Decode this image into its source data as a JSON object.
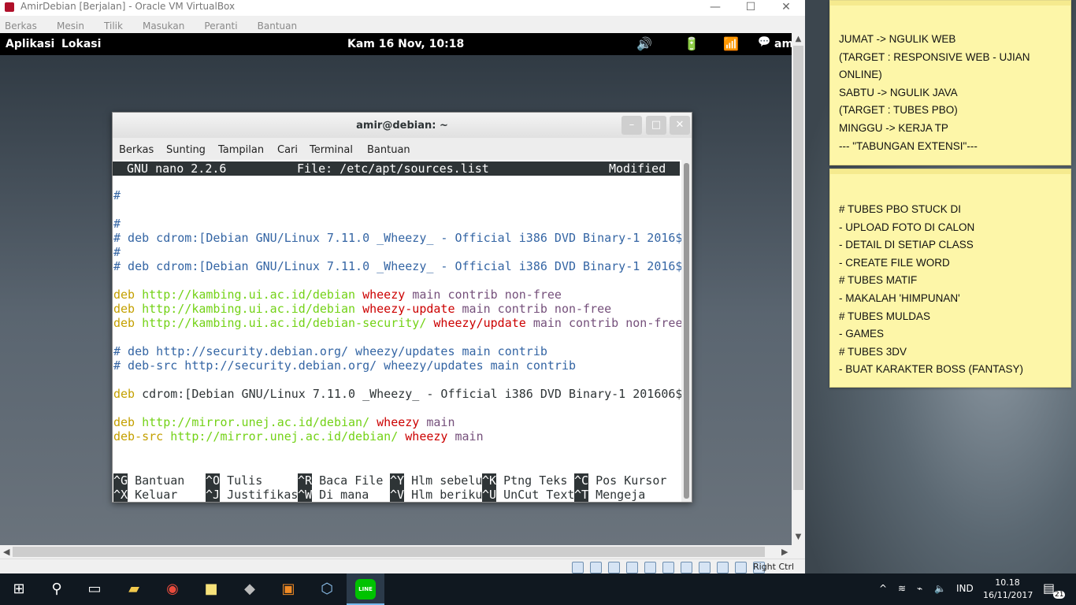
{
  "host_window": {
    "title": "AmirDebian [Berjalan] - Oracle VM VirtualBox",
    "controls": {
      "minimize": "—",
      "maximize": "☐",
      "close": "✕"
    },
    "menu": [
      "Berkas",
      "Mesin",
      "Tilik",
      "Masukan",
      "Peranti",
      "Bantuan"
    ],
    "status_right": "Right Ctrl"
  },
  "gnome_panel": {
    "left": [
      "Aplikasi",
      "Lokasi"
    ],
    "clock": "Kam 16 Nov, 10:18",
    "tray_icons": [
      "volume-icon",
      "power-icon",
      "network-icon",
      "chat-icon"
    ],
    "user": "am"
  },
  "terminal": {
    "title": "amir@debian: ~",
    "buttons": {
      "minimize": "–",
      "maximize": "□",
      "close": "✕"
    },
    "menu": [
      "Berkas",
      "Sunting",
      "Tampilan",
      "Cari",
      "Terminal",
      "Bantuan"
    ],
    "nano_header": {
      "version": "GNU nano 2.2.6",
      "file": "File: /etc/apt/sources.list",
      "status": "Modified"
    },
    "lines": [
      {
        "segments": [
          {
            "t": "#",
            "c": "com"
          }
        ]
      },
      {
        "segments": []
      },
      {
        "segments": [
          {
            "t": "#",
            "c": "com"
          }
        ]
      },
      {
        "segments": [
          {
            "t": "# deb cdrom:[Debian GNU/Linux 7.11.0 _Wheezy_ - Official i386 DVD Binary-1 2016$",
            "c": "com"
          }
        ]
      },
      {
        "segments": [
          {
            "t": "#",
            "c": "com"
          }
        ]
      },
      {
        "segments": [
          {
            "t": "# deb cdrom:[Debian GNU/Linux 7.11.0 _Wheezy_ - Official i386 DVD Binary-1 2016$",
            "c": "com"
          }
        ]
      },
      {
        "segments": []
      },
      {
        "segments": [
          {
            "t": "deb ",
            "c": "deb"
          },
          {
            "t": "http://kambing.ui.ac.id/debian ",
            "c": "url"
          },
          {
            "t": "wheezy ",
            "c": "red"
          },
          {
            "t": "main contrib non-free",
            "c": "mag"
          }
        ]
      },
      {
        "segments": [
          {
            "t": "deb ",
            "c": "deb"
          },
          {
            "t": "http://kambing.ui.ac.id/debian ",
            "c": "url"
          },
          {
            "t": "wheezy-update ",
            "c": "red"
          },
          {
            "t": "main contrib non-free",
            "c": "mag"
          }
        ]
      },
      {
        "segments": [
          {
            "t": "deb ",
            "c": "deb"
          },
          {
            "t": "http://kambing.ui.ac.id/debian-security/ ",
            "c": "url"
          },
          {
            "t": "wheezy/update ",
            "c": "red"
          },
          {
            "t": "main contrib non-free",
            "c": "mag"
          }
        ]
      },
      {
        "segments": []
      },
      {
        "segments": [
          {
            "t": "# deb http://security.debian.org/ wheezy/updates main contrib",
            "c": "com"
          }
        ]
      },
      {
        "segments": [
          {
            "t": "# deb-src http://security.debian.org/ wheezy/updates main contrib",
            "c": "com"
          }
        ]
      },
      {
        "segments": []
      },
      {
        "segments": [
          {
            "t": "deb ",
            "c": "deb"
          },
          {
            "t": "cdrom:[Debian GNU/Linux 7.11.0 _Wheezy_ - Official i386 DVD Binary-1 201606$",
            "c": "norm"
          }
        ]
      },
      {
        "segments": []
      },
      {
        "segments": [
          {
            "t": "deb ",
            "c": "deb"
          },
          {
            "t": "http://mirror.unej.ac.id/debian/ ",
            "c": "url"
          },
          {
            "t": "wheezy ",
            "c": "red"
          },
          {
            "t": "main",
            "c": "mag"
          }
        ]
      },
      {
        "segments": [
          {
            "t": "deb-src ",
            "c": "deb"
          },
          {
            "t": "http://mirror.unej.ac.id/debian/ ",
            "c": "url"
          },
          {
            "t": "wheezy ",
            "c": "red"
          },
          {
            "t": "main",
            "c": "mag"
          }
        ]
      }
    ],
    "shortcuts_row1": [
      {
        "key": "^G",
        "label": "Bantuan"
      },
      {
        "key": "^O",
        "label": "Tulis"
      },
      {
        "key": "^R",
        "label": "Baca File"
      },
      {
        "key": "^Y",
        "label": "Hlm sebelu"
      },
      {
        "key": "^K",
        "label": "Ptng Teks"
      },
      {
        "key": "^C",
        "label": "Pos Kursor"
      }
    ],
    "shortcuts_row2": [
      {
        "key": "^X",
        "label": "Keluar"
      },
      {
        "key": "^J",
        "label": "Justifikas"
      },
      {
        "key": "^W",
        "label": "Di mana"
      },
      {
        "key": "^V",
        "label": "Hlm beriku"
      },
      {
        "key": "^U",
        "label": "UnCut Text"
      },
      {
        "key": "^T",
        "label": "Mengeja"
      }
    ]
  },
  "sticky_notes": [
    {
      "lines": [
        "JUMAT -> NGULIK WEB",
        "(TARGET : RESPONSIVE WEB - UJIAN",
        "ONLINE)",
        "SABTU -> NGULIK JAVA",
        "(TARGET : TUBES PBO)",
        "MINGGU -> KERJA TP",
        "--- \"TABUNGAN EXTENSI\"---"
      ]
    },
    {
      "lines": [
        "# TUBES PBO STUCK DI",
        "- UPLOAD FOTO DI CALON",
        "- DETAIL DI SETIAP CLASS",
        "- CREATE FILE WORD",
        "# TUBES MATIF",
        "- MAKALAH 'HIMPUNAN'",
        "# TUBES MULDAS",
        "- GAMES",
        "# TUBES 3DV",
        "- BUAT KARAKTER BOSS (FANTASY)"
      ]
    }
  ],
  "taskbar": {
    "apps": [
      "start-icon",
      "search-icon",
      "task-view-icon",
      "file-explorer-icon",
      "chrome-icon",
      "sticky-notes-icon",
      "app-icon",
      "foxit-pdf-icon",
      "virtualbox-icon",
      "line-icon"
    ],
    "line_label": "LINE",
    "lang": "IND",
    "time": "10.18",
    "date": "16/11/2017",
    "notifications": "21"
  },
  "colors": {
    "comment": "#3465a4",
    "keyword_deb": "#c4a000",
    "url": "#73d216",
    "release": "#cc0000",
    "component": "#75507b",
    "sticky": "#fdf6a8"
  }
}
